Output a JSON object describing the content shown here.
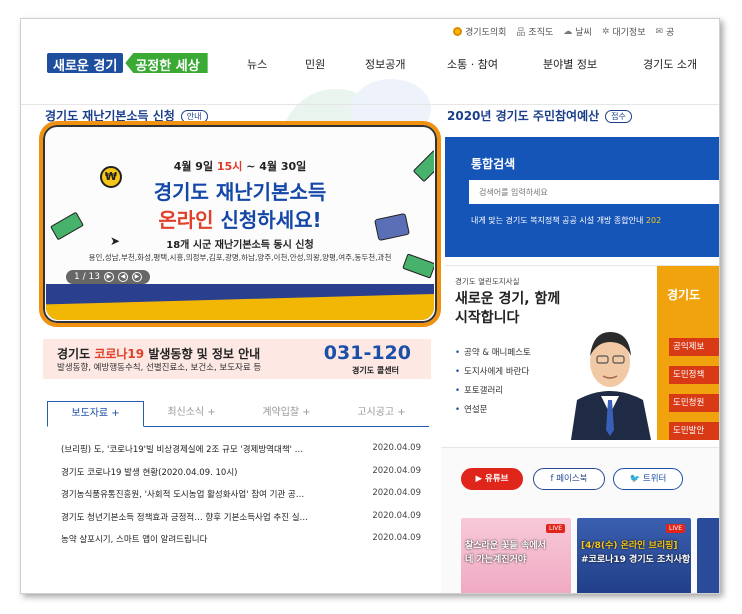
{
  "utility": {
    "items": [
      "경기도의회",
      "조직도",
      "날씨",
      "대기정보",
      "공"
    ]
  },
  "logo": {
    "part1": "새로운 경기",
    "part2": "공정한 세상"
  },
  "gnb": [
    "뉴스",
    "민원",
    "정보공개",
    "소통 · 참여",
    "분야별 정보",
    "경기도 소개"
  ],
  "left": {
    "section_title": "경기도 재난기본소득 신청",
    "section_badge": "안내",
    "banner": {
      "date_prefix": "4월 9일 ",
      "date_highlight": "15시",
      "date_suffix": " ~ 4월 30일",
      "title1": "경기도 재난기본소득",
      "title2_highlight": "온라인",
      "title2_rest": " 신청하세요!",
      "sub": "18개 시군 재난기본소득 동시 신청",
      "cities": "용인,성남,부천,화성,평택,시흥,의정부,김포,광명,하남,양주,이천,안성,의왕,양평,여주,동두천,과천",
      "pager": "1 / 13",
      "coin_symbol": "₩"
    },
    "covid": {
      "title_prefix": "경기도 ",
      "title_highlight": "코로나19",
      "title_suffix": " 발생동향 및 정보 안내",
      "sub": "발생동향, 예방행동수칙, 선별진료소, 보건소, 보도자료 등",
      "number": "031-120",
      "number_label": "경기도 콜센터"
    },
    "tabs": [
      "보도자료 +",
      "최신소식 +",
      "계약입찰 +",
      "고시공고 +"
    ],
    "news": [
      {
        "title": "(브리핑) 도, '코로나19'빌 비상경제실에 2조 규모 '경제방역대책' …",
        "date": "2020.04.09"
      },
      {
        "title": "경기도 코로나19 발생 현황(2020.04.09. 10시)",
        "date": "2020.04.09"
      },
      {
        "title": "경기농식품유통진흥원, '사회적 도시농업 활성화사업' 참여 기관 공…",
        "date": "2020.04.09"
      },
      {
        "title": "경기도 청년기본소득 정책효과 긍정적… 향후 기본소득사업 추진 실…",
        "date": "2020.04.09"
      },
      {
        "title": "농약 살포시기, 스마트 앱이 알려드립니다",
        "date": "2020.04.09"
      }
    ]
  },
  "right": {
    "budget_title": "2020년 경기도 주민참여예산",
    "budget_badge": "접수",
    "search": {
      "heading": "통합검색",
      "placeholder": "검색어를 입력하세요",
      "keywords": "내게 맞는 경기도 복지정책   공공 시설 개방 종합안내  ",
      "keywords_tail": "202"
    },
    "governor": {
      "small": "경기도 열린도지사실",
      "big": "새로운 경기, 함께 시작합니다",
      "links": [
        "공약 & 매니페스토",
        "도지사에게 바란다",
        "포토갤러리",
        "연설문"
      ]
    },
    "orange_panel": {
      "title": "경기도",
      "buttons": [
        "공익제보",
        "도민정책",
        "도민청원",
        "도민발안"
      ]
    },
    "sns": {
      "youtube": "유튜브",
      "facebook": "페이스북",
      "twitter": "트위터"
    },
    "thumbs": [
      {
        "line1": "찰스라운 꽃들 속에서",
        "line2": "네 가는계진거야",
        "live": "LIVE"
      },
      {
        "line1": "[4/8(수) 온라인 브리핑]",
        "line2": "#코로나19 경기도 조치사항",
        "live": "LIVE"
      }
    ]
  },
  "colors": {
    "primary_blue": "#1655b8",
    "accent_orange": "#f0a30c",
    "accent_red": "#e0402a",
    "logo_green": "#3aaa35"
  }
}
